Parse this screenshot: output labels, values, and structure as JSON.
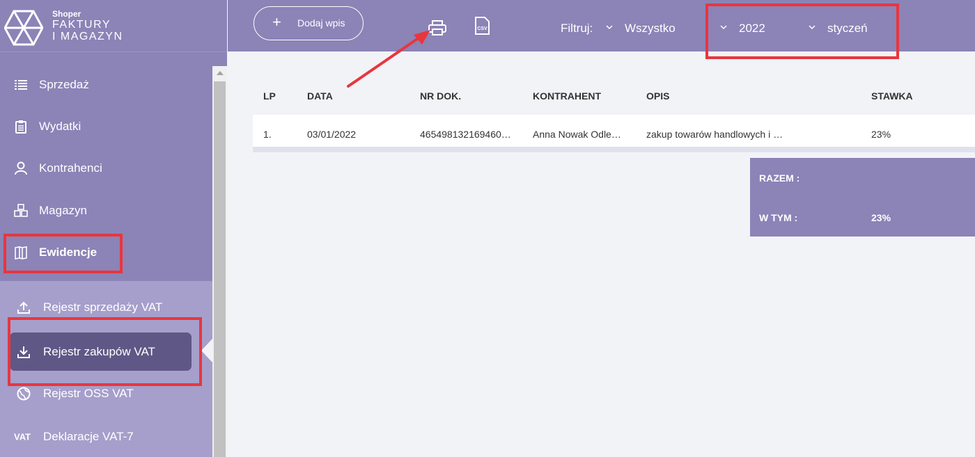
{
  "logo": {
    "small": "Shoper",
    "line1": "FAKTURY",
    "line2": "I MAGAZYN"
  },
  "nav": [
    {
      "label": "Sprzedaż",
      "icon": "list-icon"
    },
    {
      "label": "Wydatki",
      "icon": "clipboard-icon"
    },
    {
      "label": "Kontrahenci",
      "icon": "user-icon"
    },
    {
      "label": "Magazyn",
      "icon": "boxes-icon"
    },
    {
      "label": "Ewidencje",
      "icon": "book-icon",
      "active": true
    }
  ],
  "submenu": [
    {
      "label": "Rejestr sprzedaży VAT",
      "icon": "upload-icon"
    },
    {
      "label": "Rejestr zakupów VAT",
      "icon": "download-icon",
      "selected": true
    },
    {
      "label": "Rejestr OSS VAT",
      "icon": "globe-icon"
    },
    {
      "label": "Deklaracje VAT-7",
      "icon_text": "VAT"
    }
  ],
  "toolbar": {
    "add_label": "Dodaj wpis",
    "filter_label": "Filtruj:",
    "filter_value": "Wszystko",
    "year_value": "2022",
    "month_value": "styczeń",
    "csv_text": "CSV"
  },
  "table": {
    "headers": [
      "LP",
      "DATA",
      "NR DOK.",
      "KONTRAHENT",
      "OPIS",
      "STAWKA"
    ],
    "rows": [
      [
        "1.",
        "03/01/2022",
        "465498132169460…",
        "Anna Nowak Odle…",
        "zakup towarów handlowych i …",
        "23%"
      ]
    ]
  },
  "summary": {
    "total_label": "RAZEM :",
    "including_label": "W TYM :",
    "including_rate": "23%"
  },
  "colors": {
    "accent": "#8c83b7",
    "selected": "#5f5886",
    "highlight": "#e8363d"
  }
}
